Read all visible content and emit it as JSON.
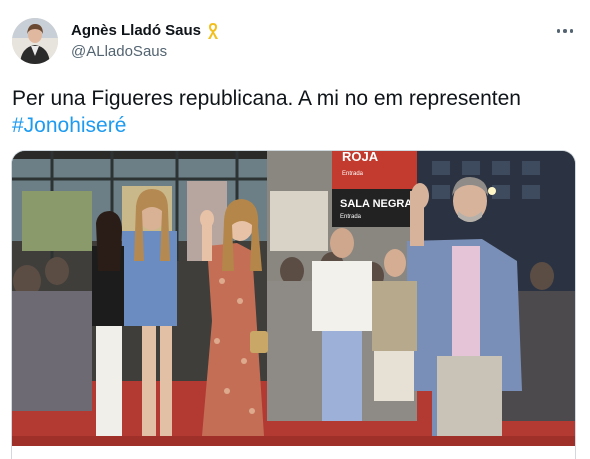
{
  "author": {
    "display_name": "Agnès Lladó Saus",
    "handle": "@ALladoSaus",
    "badge_icon": "yellow-ribbon-icon"
  },
  "tweet": {
    "text": "Per una Figueres republicana. A mi no em representen",
    "hashtag": "#Jonohiseré"
  },
  "media": {
    "signs": {
      "top_sign": "ROJA",
      "top_sign_sub": "Entrada",
      "bottom_sign": "SALA NEGRA",
      "bottom_sign_sub": "Entrada"
    }
  },
  "colors": {
    "link": "#1d9bf0",
    "secondary_text": "#536471",
    "ribbon": "#f2c01e",
    "carpet": "#b23a33"
  }
}
